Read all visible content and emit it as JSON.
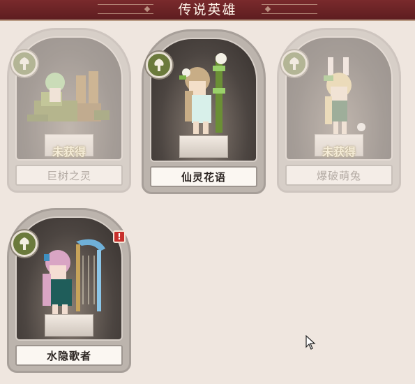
{
  "header": {
    "title": "传说英雄"
  },
  "heroes": [
    {
      "name": "巨树之灵",
      "status": "未获得",
      "obtained": false
    },
    {
      "name": "仙灵花语",
      "status": "",
      "obtained": true
    },
    {
      "name": "爆破萌兔",
      "status": "未获得",
      "obtained": false
    },
    {
      "name": "水隐歌者",
      "status": "",
      "obtained": true,
      "alert": "!"
    }
  ],
  "colors": {
    "header": "#6b2326",
    "background": "#efe6df",
    "emblem": "#6b7a3c",
    "alert": "#c8302c"
  },
  "icons": {
    "emblem": "tree-emblem-icon",
    "alert": "exclamation-icon",
    "cursor": "mouse-cursor-icon"
  }
}
